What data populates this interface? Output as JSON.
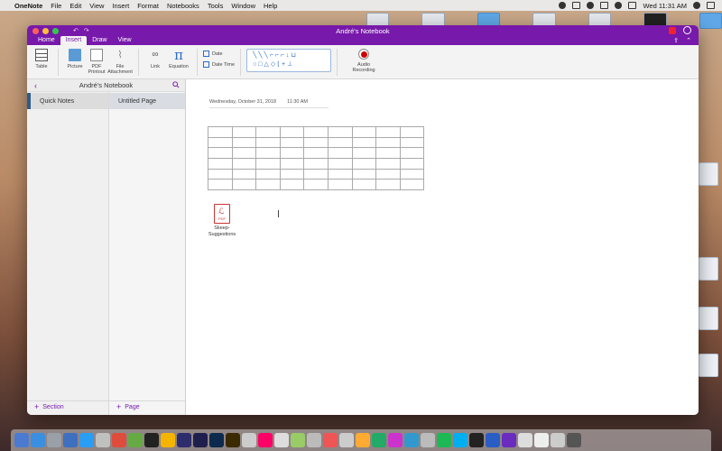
{
  "menubar": {
    "app": "OneNote",
    "items": [
      "File",
      "Edit",
      "View",
      "Insert",
      "Format",
      "Notebooks",
      "Tools",
      "Window",
      "Help"
    ],
    "clock": "Wed 11:31 AM"
  },
  "window": {
    "title": "André's Notebook",
    "tabs": [
      "Home",
      "Insert",
      "Draw",
      "View"
    ],
    "active_tab": "Insert"
  },
  "ribbon": {
    "table": "Table",
    "picture": "Picture",
    "pdf_printout": "PDF Printout",
    "file_attachment": "File Attachment",
    "link": "Link",
    "equation": "Equation",
    "date": "Date",
    "date_time": "Date  Time",
    "audio_recording": "Audio Recording"
  },
  "nav": {
    "notebook": "André's Notebook",
    "section": "Quick Notes",
    "page": "Untitled Page",
    "add_section": "Section",
    "add_page": "Page"
  },
  "page": {
    "date": "Wednesday, October 31, 2018",
    "time": "11:30 AM",
    "table": {
      "rows": 6,
      "cols": 9
    },
    "attachment": {
      "tag": "PDF",
      "name": "Skeep-Suggestions"
    }
  },
  "colors": {
    "accent": "#7719aa",
    "section_marker": "#2e5c8a"
  }
}
